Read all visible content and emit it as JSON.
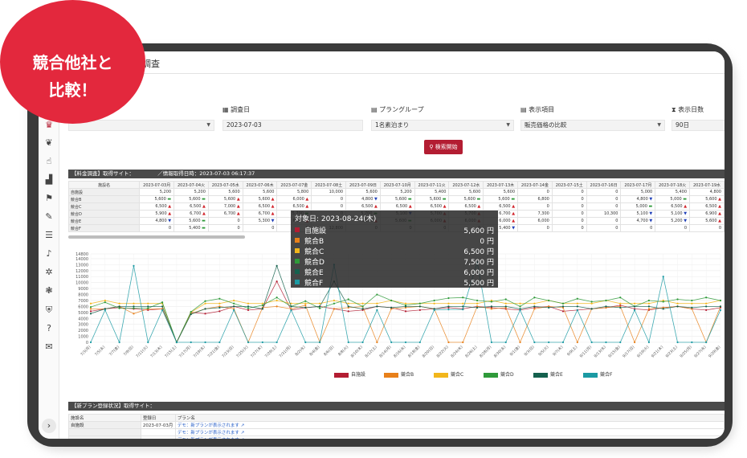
{
  "badge": {
    "line1": "競合他社と",
    "line2": "比較！"
  },
  "page_title": "合調査",
  "form": {
    "survey_date_label": "調査日",
    "survey_date_value": "2023-07-03",
    "plan_group_label": "プラングループ",
    "plan_group_value": "1名素泊まり",
    "display_item_label": "表示項目",
    "display_item_value": "販売価格の比較",
    "display_days_label": "表示日数",
    "display_days_value": "90日",
    "search_button": "検索開始"
  },
  "price_section": {
    "header": "【料金調査】取得サイト：　　　　　／情報取得日時：2023-07-03 06:17:37",
    "name_col": "施設名",
    "dates": [
      "2023-07-03月",
      "2023-07-04火",
      "2023-07-05水",
      "2023-07-06木",
      "2023-07-07金",
      "2023-07-08土",
      "2023-07-09日",
      "2023-07-10月",
      "2023-07-11火",
      "2023-07-12水",
      "2023-07-13木",
      "2023-07-14金",
      "2023-07-15土",
      "2023-07-16日",
      "2023-07-17月",
      "2023-07-18火",
      "2023-07-19水"
    ],
    "rows": [
      {
        "name": "自施設",
        "cells": [
          [
            "5,200",
            ""
          ],
          [
            "5,200",
            ""
          ],
          [
            "5,600",
            ""
          ],
          [
            "5,600",
            ""
          ],
          [
            "5,800",
            ""
          ],
          [
            "10,000",
            ""
          ],
          [
            "5,600",
            ""
          ],
          [
            "5,200",
            ""
          ],
          [
            "5,400",
            ""
          ],
          [
            "5,600",
            ""
          ],
          [
            "5,600",
            ""
          ],
          [
            "0",
            ""
          ],
          [
            "0",
            ""
          ],
          [
            "0",
            ""
          ],
          [
            "5,000",
            ""
          ],
          [
            "5,400",
            ""
          ],
          [
            "4,800",
            ""
          ]
        ]
      },
      {
        "name": "競合B",
        "cells": [
          [
            "5,600",
            "eq"
          ],
          [
            "5,600",
            "eq"
          ],
          [
            "5,600",
            "up"
          ],
          [
            "5,600",
            "up"
          ],
          [
            "6,000",
            "up"
          ],
          [
            "0",
            ""
          ],
          [
            "4,800",
            "dn"
          ],
          [
            "5,600",
            "eq"
          ],
          [
            "5,600",
            "eq"
          ],
          [
            "5,600",
            "eq"
          ],
          [
            "5,600",
            "eq"
          ],
          [
            "6,800",
            ""
          ],
          [
            "0",
            ""
          ],
          [
            "0",
            ""
          ],
          [
            "4,800",
            "dn"
          ],
          [
            "5,000",
            "eq"
          ],
          [
            "5,600",
            "up"
          ]
        ]
      },
      {
        "name": "競合C",
        "cells": [
          [
            "6,500",
            "up"
          ],
          [
            "6,500",
            "up"
          ],
          [
            "7,000",
            "up"
          ],
          [
            "6,500",
            "up"
          ],
          [
            "6,500",
            "up"
          ],
          [
            "0",
            ""
          ],
          [
            "6,500",
            "up"
          ],
          [
            "6,500",
            "up"
          ],
          [
            "6,500",
            "up"
          ],
          [
            "6,500",
            "up"
          ],
          [
            "6,500",
            "up"
          ],
          [
            "0",
            ""
          ],
          [
            "0",
            ""
          ],
          [
            "0",
            ""
          ],
          [
            "5,000",
            "eq"
          ],
          [
            "6,500",
            "up"
          ],
          [
            "6,500",
            "up"
          ]
        ]
      },
      {
        "name": "競合D",
        "cells": [
          [
            "5,900",
            "up"
          ],
          [
            "6,700",
            "up"
          ],
          [
            "6,700",
            "up"
          ],
          [
            "6,700",
            "up"
          ],
          [
            "5,700",
            "eq"
          ],
          [
            "0",
            ""
          ],
          [
            "5,700",
            "eq"
          ],
          [
            "5,100",
            "dn"
          ],
          [
            "5,700",
            "up"
          ],
          [
            "5,700",
            "up"
          ],
          [
            "6,700",
            "up"
          ],
          [
            "7,300",
            ""
          ],
          [
            "0",
            ""
          ],
          [
            "10,300",
            ""
          ],
          [
            "5,100",
            "dn"
          ],
          [
            "5,100",
            "dn"
          ],
          [
            "6,900",
            "up"
          ]
        ]
      },
      {
        "name": "競合E",
        "cells": [
          [
            "4,800",
            "dn"
          ],
          [
            "5,600",
            "eq"
          ],
          [
            "0",
            ""
          ],
          [
            "5,300",
            "dn"
          ],
          [
            "6,000",
            "up"
          ],
          [
            "0",
            ""
          ],
          [
            "6,000",
            "up"
          ],
          [
            "5,600",
            "eq"
          ],
          [
            "6,000",
            "up"
          ],
          [
            "6,000",
            "up"
          ],
          [
            "6,000",
            "up"
          ],
          [
            "6,000",
            ""
          ],
          [
            "0",
            ""
          ],
          [
            "0",
            ""
          ],
          [
            "4,700",
            "dn"
          ],
          [
            "5,200",
            "dn"
          ],
          [
            "5,600",
            "up"
          ]
        ]
      },
      {
        "name": "競合F",
        "cells": [
          [
            "0",
            ""
          ],
          [
            "5,400",
            "eq"
          ],
          [
            "0",
            ""
          ],
          [
            "0",
            ""
          ],
          [
            "0",
            ""
          ],
          [
            "12,800",
            ""
          ],
          [
            "0",
            ""
          ],
          [
            "0",
            ""
          ],
          [
            "0",
            ""
          ],
          [
            "0",
            ""
          ],
          [
            "5,400",
            "dn"
          ],
          [
            "0",
            ""
          ],
          [
            "0",
            ""
          ],
          [
            "0",
            ""
          ],
          [
            "0",
            ""
          ],
          [
            "0",
            ""
          ],
          [
            "0",
            ""
          ]
        ]
      }
    ]
  },
  "tooltip": {
    "date": "対象日: 2023-08-24(木)",
    "rows": [
      {
        "name": "自施設",
        "value": "5,600 円",
        "color": "#b31d32"
      },
      {
        "name": "競合B",
        "value": "0 円",
        "color": "#e8801a"
      },
      {
        "name": "競合C",
        "value": "6,500 円",
        "color": "#f2b61c"
      },
      {
        "name": "競合D",
        "value": "7,500 円",
        "color": "#2f9a3a"
      },
      {
        "name": "競合E",
        "value": "6,000 円",
        "color": "#15614e"
      },
      {
        "name": "競合F",
        "value": "5,500 円",
        "color": "#1b9aa3"
      }
    ]
  },
  "chart_data": {
    "type": "line",
    "ylim": [
      0,
      14800
    ],
    "yticks": [
      "0",
      "1000",
      "2000",
      "3000",
      "4000",
      "5000",
      "6000",
      "7000",
      "8000",
      "9000",
      "10000",
      "11000",
      "12000",
      "13000",
      "14000",
      "14800"
    ],
    "x": [
      "7/3(月)",
      "7/5(水)",
      "7/7(金)",
      "7/9(日)",
      "7/11(火)",
      "7/13(木)",
      "7/15(土)",
      "7/17(月)",
      "7/19(水)",
      "7/21(金)",
      "7/23(日)",
      "7/25(火)",
      "7/27(木)",
      "7/29(土)",
      "7/31(月)",
      "8/2(水)",
      "8/4(金)",
      "8/6(日)",
      "8/8(火)",
      "8/10(木)",
      "8/12(土)",
      "8/14(月)",
      "8/16(水)",
      "8/18(金)",
      "8/20(日)",
      "8/22(火)",
      "8/24(木)",
      "8/26(土)",
      "8/28(月)",
      "8/30(水)",
      "9/1(金)",
      "9/3(日)",
      "9/5(火)",
      "9/7(木)",
      "9/9(土)",
      "9/11(月)",
      "9/13(水)",
      "9/15(金)",
      "9/17(日)",
      "9/19(火)",
      "9/21(木)",
      "9/23(土)",
      "9/25(月)",
      "9/27(水)",
      "9/29(金)"
    ],
    "legend": [
      "自施設",
      "競合B",
      "競合C",
      "競合D",
      "競合E",
      "競合F"
    ],
    "colors": [
      "#b31d32",
      "#e8801a",
      "#f2b61c",
      "#2f9a3a",
      "#15614e",
      "#1b9aa3"
    ],
    "series": [
      {
        "name": "自施設",
        "values": [
          5200,
          5600,
          5800,
          5600,
          5400,
          5600,
          0,
          5000,
          4800,
          5200,
          6000,
          5400,
          5600,
          10200,
          5400,
          5800,
          6000,
          5600,
          5200,
          5400,
          6000,
          5800,
          5200,
          5400,
          5600,
          5800,
          5600,
          6000,
          5800,
          5600,
          5400,
          5800,
          6000,
          5200,
          5400,
          5600,
          5800,
          6200,
          5600,
          5400,
          5800,
          6000,
          5600,
          5400,
          5800
        ]
      },
      {
        "name": "競合B",
        "values": [
          5600,
          5600,
          6000,
          4800,
          5600,
          5600,
          0,
          4800,
          5600,
          6000,
          5600,
          0,
          5800,
          6000,
          5600,
          6200,
          0,
          5600,
          5800,
          6000,
          0,
          5600,
          5800,
          6000,
          5600,
          0,
          0,
          6000,
          5600,
          5800,
          0,
          5600,
          6000,
          5800,
          0,
          5600,
          5800,
          6000,
          0,
          5600,
          5800,
          6000,
          5600,
          0,
          6000
        ]
      },
      {
        "name": "競合C",
        "values": [
          6500,
          7000,
          6500,
          6500,
          6500,
          6500,
          0,
          5000,
          6500,
          6500,
          7000,
          6500,
          6500,
          7000,
          6500,
          6500,
          6500,
          7000,
          6500,
          6500,
          6500,
          7000,
          6500,
          6500,
          6500,
          6500,
          6500,
          6500,
          7000,
          6500,
          6500,
          6500,
          7000,
          6500,
          6500,
          6500,
          7000,
          6500,
          6500,
          6500,
          7000,
          6500,
          6500,
          6500,
          7000
        ]
      },
      {
        "name": "競合D",
        "values": [
          5900,
          6700,
          5700,
          5700,
          5700,
          6700,
          0,
          5100,
          6900,
          7300,
          6500,
          5700,
          6200,
          7500,
          6000,
          6900,
          5700,
          6500,
          7200,
          6000,
          8000,
          7000,
          6200,
          6500,
          7000,
          7400,
          7500,
          7000,
          6800,
          7200,
          6000,
          7500,
          7000,
          6500,
          7300,
          6800,
          7000,
          7500,
          6000,
          7000,
          6800,
          7200,
          7000,
          7500,
          7000
        ]
      },
      {
        "name": "競合E",
        "values": [
          4800,
          5600,
          6000,
          6000,
          6000,
          6000,
          0,
          4700,
          5600,
          5800,
          6000,
          6000,
          5600,
          12800,
          6000,
          5800,
          6000,
          10200,
          6000,
          5600,
          6000,
          5800,
          6000,
          6000,
          5600,
          6000,
          6000,
          5800,
          6000,
          6000,
          5600,
          6000,
          5800,
          6000,
          6000,
          5600,
          6000,
          5800,
          6000,
          6000,
          5600,
          6000,
          5800,
          6000,
          6000
        ]
      },
      {
        "name": "競合F",
        "values": [
          0,
          5400,
          0,
          12800,
          0,
          5400,
          0,
          0,
          0,
          0,
          5400,
          0,
          0,
          0,
          5400,
          0,
          0,
          13000,
          0,
          0,
          5400,
          0,
          0,
          0,
          5400,
          5500,
          5500,
          13400,
          0,
          0,
          5400,
          0,
          0,
          0,
          5400,
          0,
          0,
          0,
          5400,
          0,
          11000,
          0,
          0,
          0,
          5400
        ]
      }
    ]
  },
  "plans_section": {
    "header": "【新プラン登録状況】取得サイト：",
    "col_facility": "施設名",
    "col_date": "登録日",
    "col_plan": "プラン名",
    "rows": [
      {
        "facility": "自施設",
        "date": "2023-07-03月",
        "plan": "デモ：新プランが表示されます"
      },
      {
        "facility": "",
        "date": "",
        "plan": "デモ：新プランが表示されます"
      },
      {
        "facility": "",
        "date": "",
        "plan": "デモ：新プランが表示されます"
      }
    ]
  },
  "sidebar_icons": [
    "logo-icon",
    "leaf-icon",
    "hand-icon",
    "chart-icon",
    "flag-icon",
    "edit-icon",
    "list-icon",
    "bell-icon",
    "gear-icon",
    "cogs-icon",
    "shield-icon",
    "help-icon",
    "mail-icon"
  ],
  "expand_button": "›"
}
